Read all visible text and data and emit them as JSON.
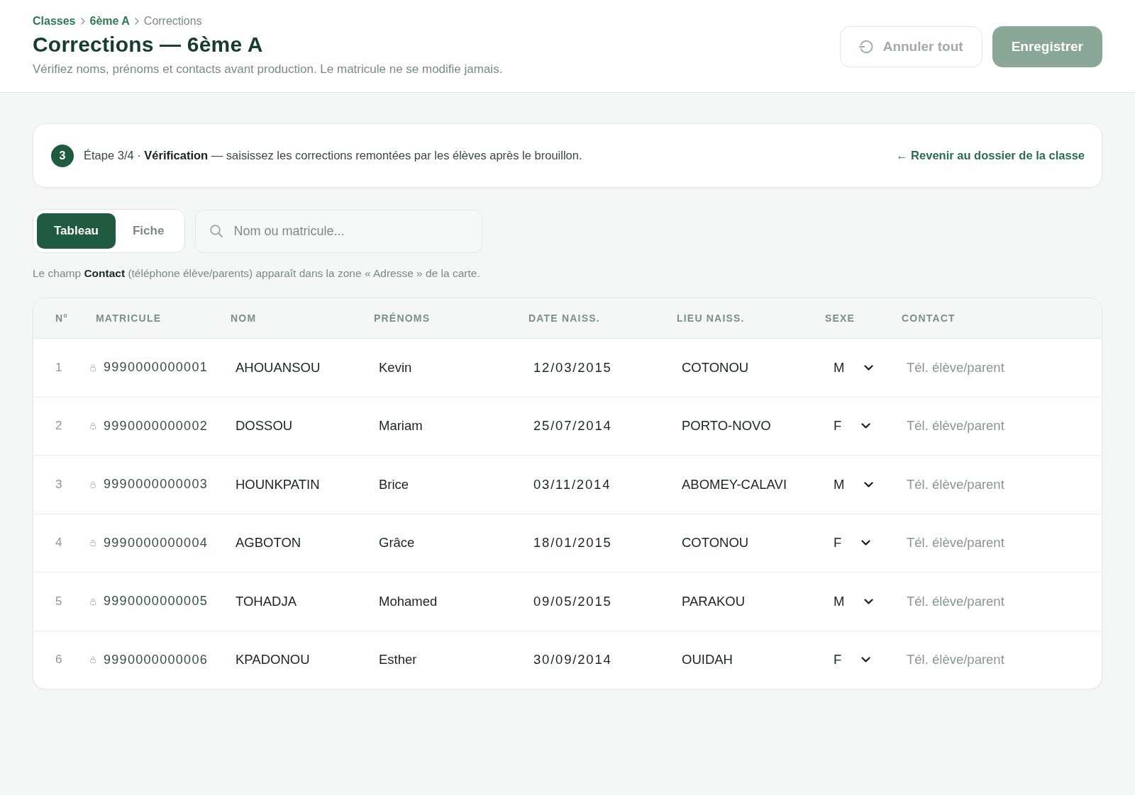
{
  "header": {
    "breadcrumb": [
      {
        "label": "Classes",
        "current": false
      },
      {
        "label": "6ème A",
        "current": false
      },
      {
        "label": "Corrections",
        "current": true
      }
    ],
    "title": "Corrections — 6ème A",
    "subtitle": "Vérifiez noms, prénoms et contacts avant production. Le matricule ne se modifie jamais.",
    "actions": [
      {
        "kind": "secondary",
        "label": "Annuler tout",
        "disabled": true
      },
      {
        "kind": "primary",
        "label": "Enregistrer",
        "disabled": true
      }
    ]
  },
  "step": {
    "badge": "3",
    "text": "Étape 3/4 · **Vérification** — saisissez les corrections remontées par les élèves après le brouillon.",
    "link": "← Revenir au dossier de la classe"
  },
  "view_tabs": [
    {
      "label": "Tableau",
      "selected": true
    },
    {
      "label": "Fiche",
      "selected": false
    }
  ],
  "search": {
    "placeholder": "Nom ou matricule..."
  },
  "note": "Le champ **Contact** (téléphone élève/parents) apparaît dans la zone « Adresse » de la carte.",
  "table": {
    "columns": [
      "N°",
      "MATRICULE",
      "NOM",
      "PRÉNOMS",
      "DATE NAISS.",
      "LIEU NAISS.",
      "SEXE",
      "CONTACT"
    ],
    "rows": [
      {
        "number": "1",
        "matricule": "9990000000001",
        "nom": "AHOUANSOU",
        "prenoms": "Kevin",
        "date_naissance": "12/03/2015",
        "lieu_naissance": "COTONOU",
        "sexe": "M",
        "contact": {
          "placeholder": "Tél. élève/parent"
        }
      },
      {
        "number": "2",
        "matricule": "9990000000002",
        "nom": "DOSSOU",
        "prenoms": "Mariam",
        "date_naissance": "25/07/2014",
        "lieu_naissance": "PORTO-NOVO",
        "sexe": "F",
        "contact": {
          "placeholder": "Tél. élève/parent"
        }
      },
      {
        "number": "3",
        "matricule": "9990000000003",
        "nom": "HOUNKPATIN",
        "prenoms": "Brice",
        "date_naissance": "03/11/2014",
        "lieu_naissance": "ABOMEY-CALAVI",
        "sexe": "M",
        "contact": {
          "placeholder": "Tél. élève/parent"
        }
      },
      {
        "number": "4",
        "matricule": "9990000000004",
        "nom": "AGBOTON",
        "prenoms": "Grâce",
        "date_naissance": "18/01/2015",
        "lieu_naissance": "COTONOU",
        "sexe": "F",
        "contact": {
          "placeholder": "Tél. élève/parent"
        }
      },
      {
        "number": "5",
        "matricule": "9990000000005",
        "nom": "TOHADJA",
        "prenoms": "Mohamed",
        "date_naissance": "09/05/2015",
        "lieu_naissance": "PARAKOU",
        "sexe": "M",
        "contact": {
          "placeholder": "Tél. élève/parent"
        }
      },
      {
        "number": "6",
        "matricule": "9990000000006",
        "nom": "KPADONOU",
        "prenoms": "Esther",
        "date_naissance": "30/09/2014",
        "lieu_naissance": "OUIDAH",
        "sexe": "F",
        "contact": {
          "placeholder": "Tél. élève/parent"
        }
      }
    ]
  }
}
